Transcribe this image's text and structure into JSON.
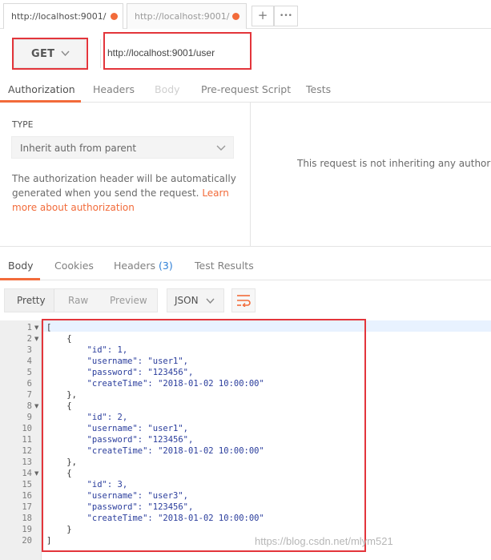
{
  "tabs": {
    "items": [
      {
        "label": "http://localhost:9001/"
      },
      {
        "label": "http://localhost:9001/"
      }
    ],
    "add_label": "+",
    "more_label": "•••"
  },
  "request": {
    "method": "GET",
    "url": "http://localhost:9001/user"
  },
  "request_tabs": {
    "authorization": "Authorization",
    "headers": "Headers",
    "body": "Body",
    "prerequest": "Pre-request Script",
    "tests": "Tests"
  },
  "auth": {
    "type_label": "TYPE",
    "type_value": "Inherit auth from parent",
    "description": "The authorization header will be automatically generated when you send the request. ",
    "link_text": "Learn more about authorization",
    "inherit_message": "This request is not inheriting any authorizat"
  },
  "response_tabs": {
    "body": "Body",
    "cookies": "Cookies",
    "headers": "Headers",
    "headers_count": "(3)",
    "test_results": "Test Results"
  },
  "response_toolbar": {
    "pretty": "Pretty",
    "raw": "Raw",
    "preview": "Preview",
    "language": "JSON"
  },
  "response_body": {
    "line_numbers": [
      "1",
      "2",
      "3",
      "4",
      "5",
      "6",
      "7",
      "8",
      "9",
      "10",
      "11",
      "12",
      "13",
      "14",
      "15",
      "16",
      "17",
      "18",
      "19",
      "20"
    ],
    "lines": [
      "[",
      "    {",
      "        \"id\": 1,",
      "        \"username\": \"user1\",",
      "        \"password\": \"123456\",",
      "        \"createTime\": \"2018-01-02 10:00:00\"",
      "    },",
      "    {",
      "        \"id\": 2,",
      "        \"username\": \"user1\",",
      "        \"password\": \"123456\",",
      "        \"createTime\": \"2018-01-02 10:00:00\"",
      "    },",
      "    {",
      "        \"id\": 3,",
      "        \"username\": \"user3\",",
      "        \"password\": \"123456\",",
      "        \"createTime\": \"2018-01-02 10:00:00\"",
      "    }",
      "]"
    ]
  },
  "watermark": "https://blog.csdn.net/mlym521",
  "colors": {
    "accent": "#f26b3a",
    "highlight_box": "#e3353b",
    "badge": "#2e7fd6"
  }
}
